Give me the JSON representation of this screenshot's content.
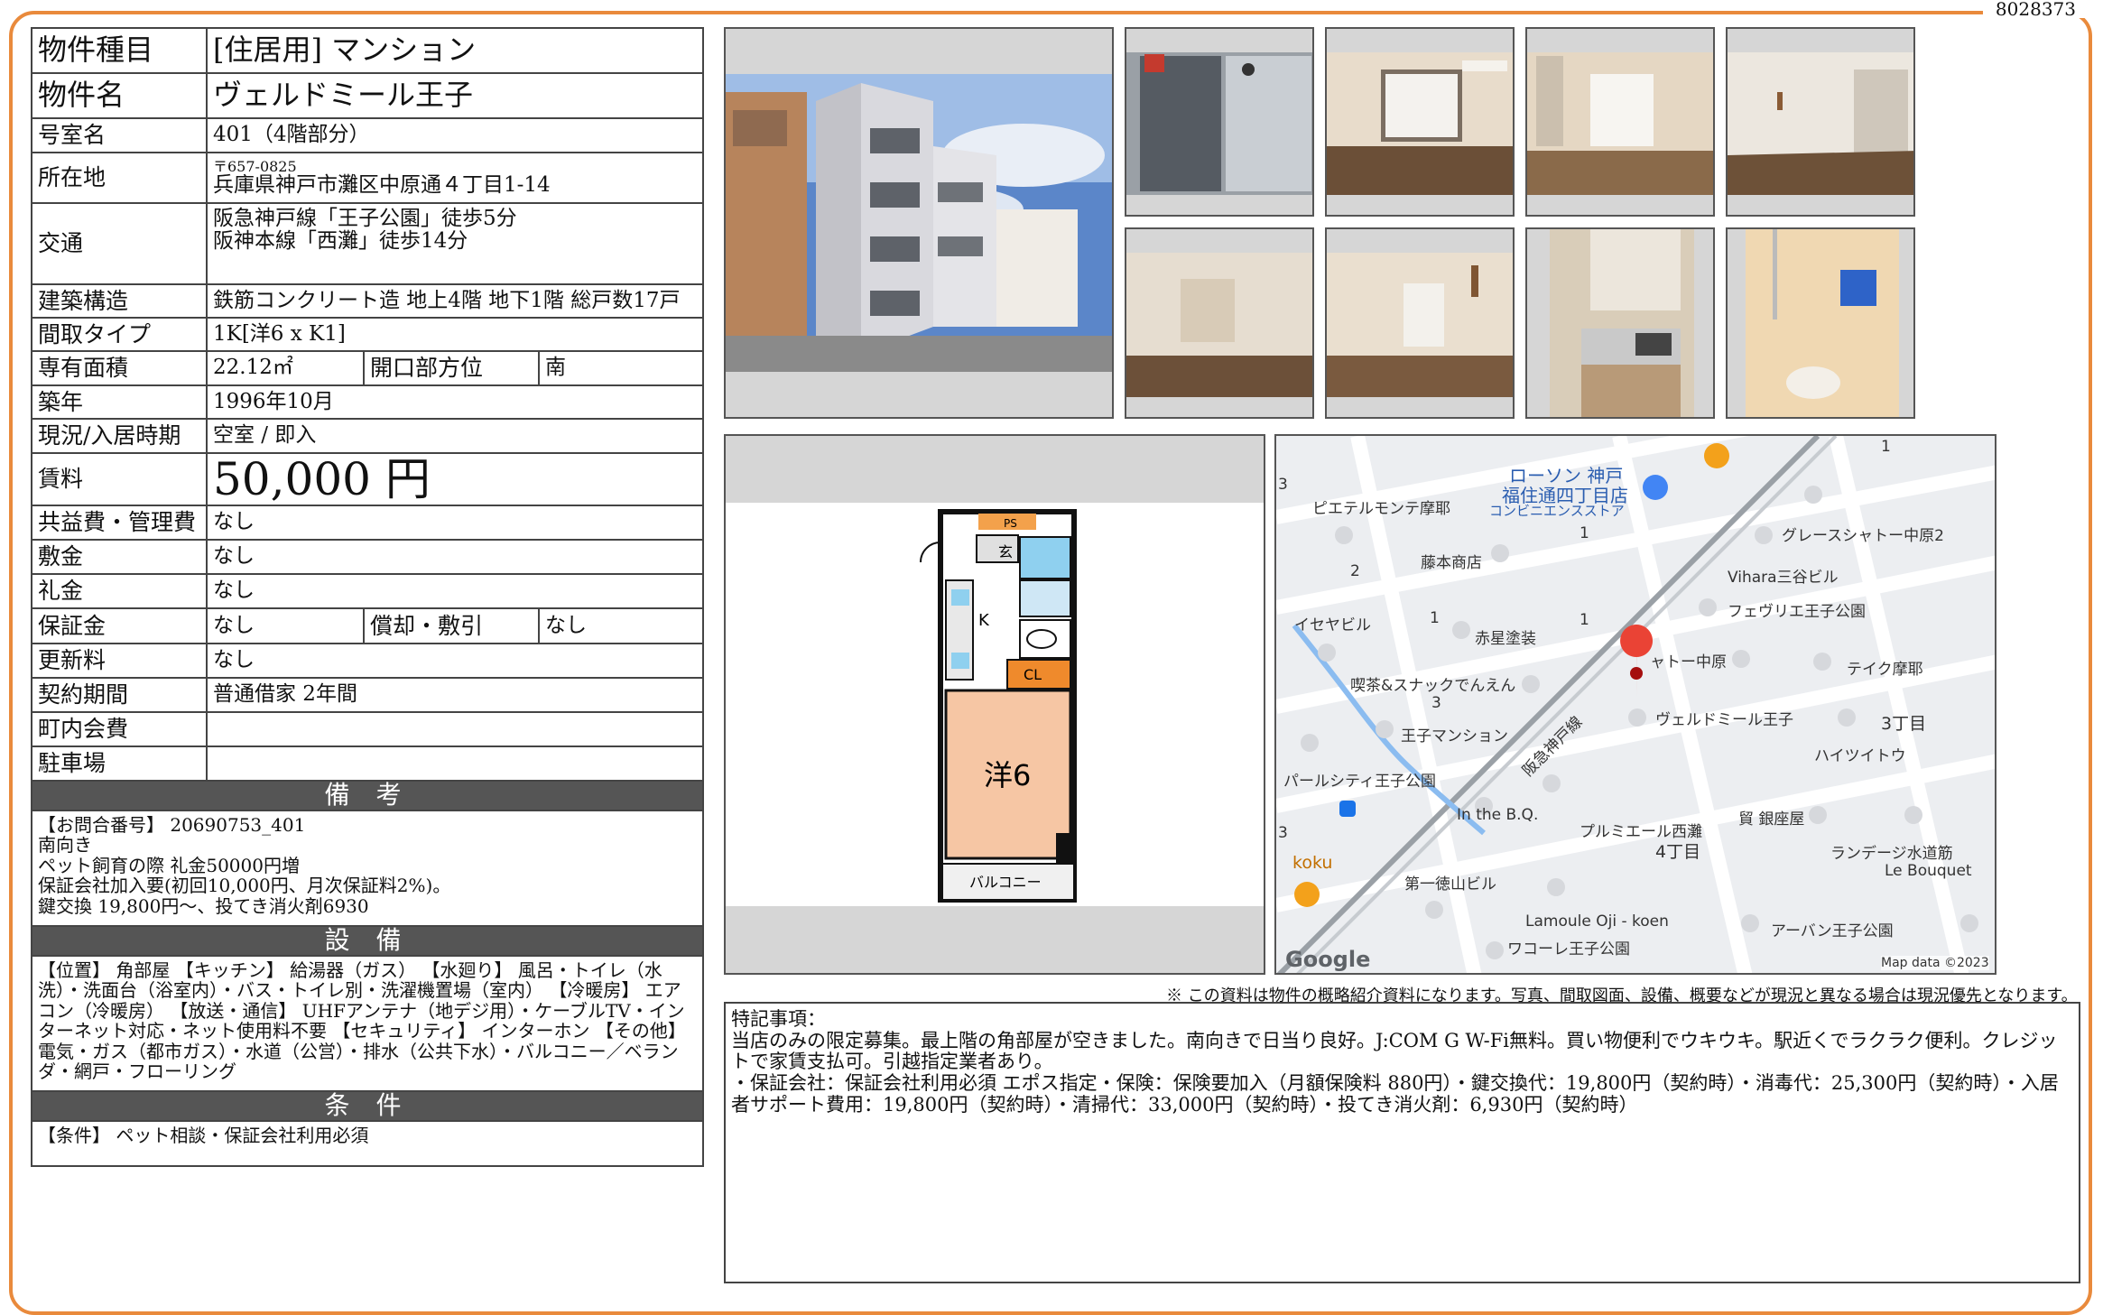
{
  "doc_number": "8028373",
  "property": {
    "type_label": "物件種目",
    "type_value": "[住居用] マンション",
    "name_label": "物件名",
    "name_value": "ヴェルドミール王子",
    "room_label": "号室名",
    "room_value": "401（4階部分）",
    "address_label": "所在地",
    "postal": "〒657-0825",
    "address": "兵庫県神戸市灘区中原通４丁目1-14",
    "transport_label": "交通",
    "transport_1": "阪急神戸線「王子公園」徒歩5分",
    "transport_2": "阪神本線「西灘」徒歩14分",
    "structure_label": "建築構造",
    "structure_value": "鉄筋コンクリート造 地上4階 地下1階 総戸数17戸",
    "layout_label": "間取タイプ",
    "layout_value": "1K[洋6 x K1]",
    "area_label": "専有面積",
    "area_value": "22.12㎡",
    "direction_label": "開口部方位",
    "direction_value": "南",
    "built_label": "築年",
    "built_value": "1996年10月",
    "status_label": "現況/入居時期",
    "status_value": "空室 / 即入",
    "rent_label": "賃料",
    "rent_value": "50,000 円",
    "common_fee_label": "共益費・管理費",
    "common_fee_value": "なし",
    "deposit_label": "敷金",
    "deposit_value": "なし",
    "key_money_label": "礼金",
    "key_money_value": "なし",
    "guarantee_label": "保証金",
    "guarantee_value": "なし",
    "amortization_label": "償却・敷引",
    "amortization_value": "なし",
    "renewal_label": "更新料",
    "renewal_value": "なし",
    "contract_label": "契約期間",
    "contract_value": "普通借家 2年間",
    "town_fee_label": "町内会費",
    "town_fee_value": "",
    "parking_label": "駐車場",
    "parking_value": ""
  },
  "remarks_section": {
    "title": "備 考",
    "lines": [
      "【お問合番号】 20690753_401",
      "南向き",
      "ペット飼育の際 礼金50000円増",
      "保証会社加入要(初回10,000円、月次保証料2%)。",
      "鍵交換 19,800円〜、投てき消火剤6930"
    ]
  },
  "equipment_section": {
    "title": "設 備",
    "text": "【位置】 角部屋 【キッチン】 給湯器（ガス） 【水廻り】 風呂・トイレ（水洗）・洗面台（浴室内）・バス・トイレ別・洗濯機置場（室内） 【冷暖房】 エアコン（冷暖房） 【放送・通信】 UHFアンテナ（地デジ用）・ケーブルTV・インターネット対応・ネット使用料不要 【セキュリティ】 インターホン 【その他】 電気・ガス（都市ガス）・水道（公営）・排水（公共下水）・バルコニー／ベランダ・網戸・フローリング"
  },
  "conditions_section": {
    "title": "条 件",
    "text": "【条件】 ペット相談・保証会社利用必須"
  },
  "floorplan": {
    "ps": "PS",
    "genkan": "玄",
    "kitchen": "K",
    "closet": "CL",
    "room": "洋6",
    "balcony": "バルコニー"
  },
  "map": {
    "labels": {
      "lawson": "ローソン 神戸",
      "lawson2": "福住通四丁目店",
      "lawson3": "コンビニエンスストア",
      "pierre": "ピエテルモンテ摩耶",
      "fujimoto": "藤本商店",
      "grace": "グレースシャトー中原2",
      "vihara": "Vihara三谷ビル",
      "fevrier": "フェヴリエ王子公園",
      "iseya": "イセヤビル",
      "akahoshi": "赤星塗装",
      "shatochuhara": "ャトー中原",
      "teiku": "テイク摩耶",
      "kissa": "喫茶&スナックでんえん",
      "verdmir": "ヴェルドミール王子",
      "oji_mansion": "王子マンション",
      "hankyu": "阪急神戸線",
      "chome3": "3丁目",
      "haits": "ハイツイトウ",
      "parl": "パールシティ王子公園",
      "inthebq": "In the B.Q.",
      "plumier": "プルミエール西灘",
      "chome4": "4丁目",
      "ginza": "貿 銀座屋",
      "rendage": "ランデージ水道筋",
      "lebouquet": "Le Bouquet",
      "koku": "koku",
      "tokuyama": "第一徳山ビル",
      "lamoule": "Lamoule Oji - koen",
      "urban": "アーバン王子公園",
      "wacoal": "ワコーレ王子公園",
      "google": "Google",
      "mapdata": "Map data ©2023",
      "n1a": "1",
      "n1b": "1",
      "n1c": "1",
      "n1d": "1",
      "n2": "2",
      "n3a": "3",
      "n3b": "3",
      "n3c": "3"
    }
  },
  "disclaimer": "※ この資料は物件の概略紹介資料になります。写真、間取図面、設備、概要などが現況と異なる場合は現況優先となります。",
  "special_notes": {
    "title": "特記事項：",
    "p1": "当店のみの限定募集。最上階の角部屋が空きました。南向きで日当り良好。J:COM G W-Fi無料。買い物便利でウキウキ。駅近くでラクラク便利。クレジットで家賃支払可。引越指定業者あり。",
    "p2": "・保証会社：保証会社利用必須 エポス指定・保険：保険要加入（月額保険料 880円）・鍵交換代：19,800円（契約時）・消毒代：25,300円（契約時）・入居者サポート費用：19,800円（契約時）・清掃代：33,000円（契約時）・投てき消火剤：6,930円（契約時）"
  }
}
